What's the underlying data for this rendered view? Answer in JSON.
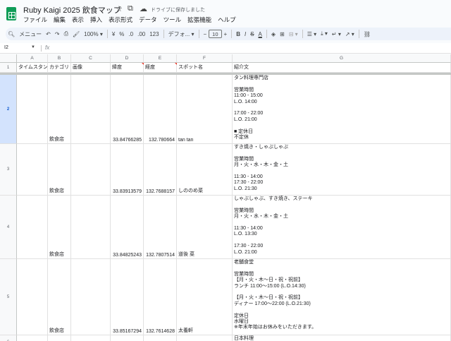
{
  "app": {
    "title": "Ruby Kaigi 2025 飲食マップ",
    "saved_status": "ドライブに保存しました",
    "menus": [
      "ファイル",
      "編集",
      "表示",
      "挿入",
      "表示形式",
      "データ",
      "ツール",
      "拡張機能",
      "ヘルプ"
    ]
  },
  "toolbar": {
    "menu_label": "メニュー",
    "zoom": "100%",
    "currency": "¥",
    "percent": "%",
    "dec_decrease": ".0",
    "dec_increase": ".00",
    "number_format": "123",
    "font": "デフォ...",
    "font_size": "10"
  },
  "formula_bar": {
    "cell_ref": "I2",
    "fx": "fx",
    "content": ""
  },
  "sheet": {
    "columns": [
      "A",
      "B",
      "C",
      "D",
      "E",
      "F",
      "G"
    ],
    "header_row": {
      "number": "1",
      "cells": [
        "タイムスタン",
        "カテゴリ",
        "画像",
        "緯度",
        "経度",
        "スポット名",
        "紹介文"
      ]
    },
    "rows": [
      {
        "number": "2",
        "category": "飲食店",
        "lat": "33.84766285",
        "lng": "132.780664",
        "name": "tan tan",
        "intro": "タン料理専門店\n\n営業時間\n11:00 - 15:00\nL.O. 14:00\n\n17:00 - 22:00\nL.O. 21:00\n\n■ 定休日\n不定休"
      },
      {
        "number": "3",
        "category": "飲食店",
        "lat": "33.83913579",
        "lng": "132.7688157",
        "name": "しののめ菜",
        "intro": "すき焼き・しゃぶしゃぶ\n\n営業時間\n月・火・水・木・金・土\n\n11:30 - 14:00\n17:30 - 22:00\nL.O. 21:30"
      },
      {
        "number": "4",
        "category": "飲食店",
        "lat": "33.84825243",
        "lng": "132.7807514",
        "name": "道後 菜",
        "intro": "しゃぶしゃぶ、すき焼き、ステーキ\n\n営業時間\n月・火・水・木・金・土\n\n11:30 - 14:00\nL.O. 13:30\n\n17:30 - 22:00\nL.O. 21:00"
      },
      {
        "number": "5",
        "category": "飲食店",
        "lat": "33.85167294",
        "lng": "132.7614628",
        "name": "太養軒",
        "intro": "老舗食堂\n\n営業時間\n【月・火・木〜日・祝・祝前】\nランチ 11:00〜15:00 (L.O.14:30)\n\n【月・火・木〜日・祝・祝前】\nディナー 17:00〜22:00 (L.O.21:30)\n\n定休日\n水曜日\n※年末年始はお休みをいただきます。"
      },
      {
        "number": "6",
        "category": "",
        "lat": "",
        "lng": "",
        "name": "",
        "intro": "日本料理"
      }
    ]
  }
}
